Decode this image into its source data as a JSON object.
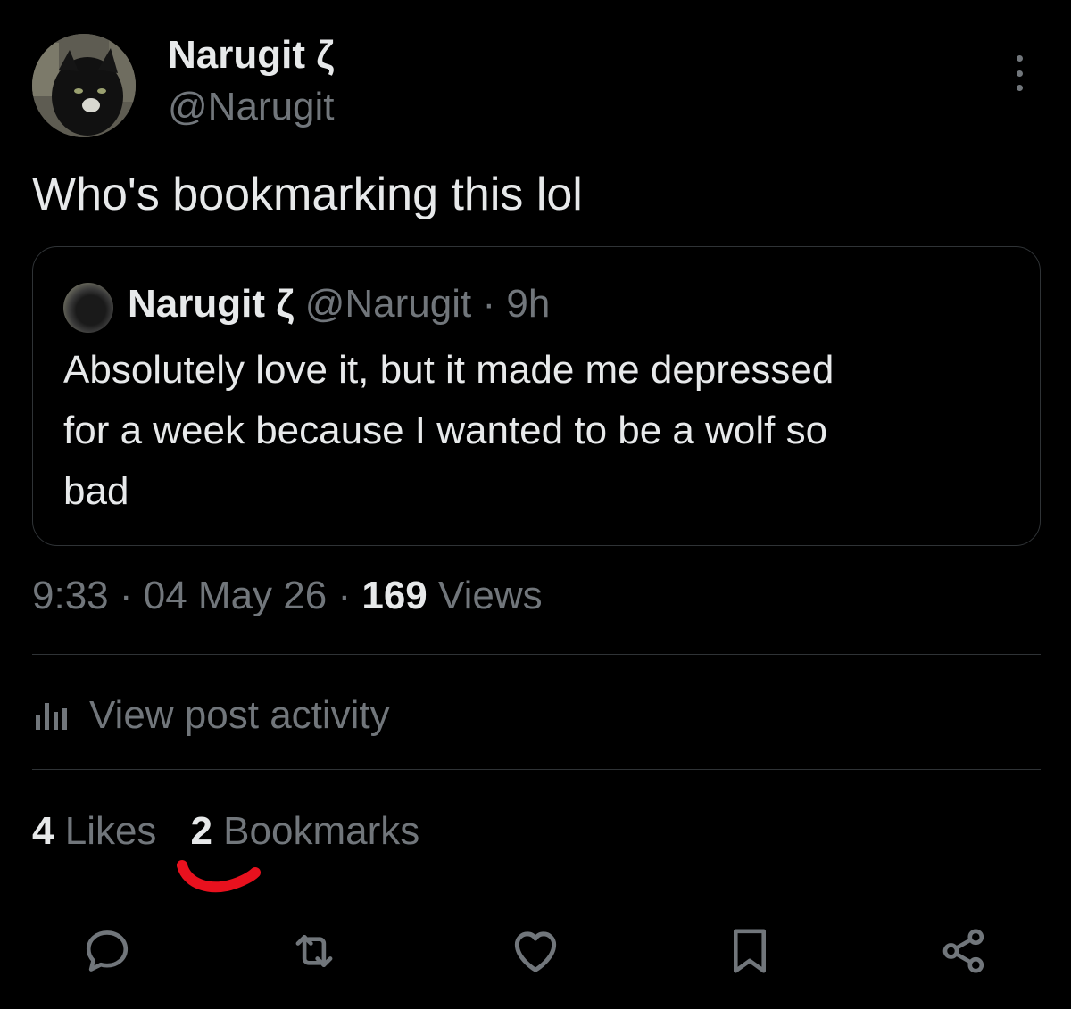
{
  "post": {
    "author": {
      "display_name": "Narugit ζ",
      "handle": "@Narugit"
    },
    "text": "Who's bookmarking this lol",
    "quoted_post": {
      "display_name": "Narugit ζ",
      "handle": "@Narugit",
      "separator": "·",
      "time": "9h",
      "text": "Absolutely love it, but it made me depressed\nfor a week because I wanted to be a wolf so\nbad"
    },
    "meta": {
      "time": "9:33",
      "separator": "·",
      "date": "04 May 26",
      "views_count": "169",
      "views_label": "Views"
    },
    "activity_label": "View post activity",
    "stats": {
      "likes_count": "4",
      "likes_label": "Likes",
      "bookmarks_count": "2",
      "bookmarks_label": "Bookmarks"
    }
  },
  "actions": [
    "reply-icon",
    "repost-icon",
    "like-icon",
    "bookmark-icon",
    "share-icon"
  ],
  "colors": {
    "background": "#000000",
    "text_primary": "#e7e9ea",
    "text_secondary": "#71767b",
    "border": "#2f3336",
    "annotation_red": "#e8111e"
  }
}
